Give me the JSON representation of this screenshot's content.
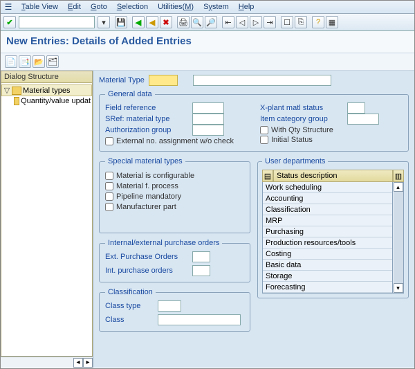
{
  "menu": {
    "control_icon": "window-menu-icon",
    "items": [
      "Table View",
      "Edit",
      "Goto",
      "Selection",
      "Utilities(M)",
      "System",
      "Help"
    ]
  },
  "toolbar": {
    "ok_btn": "✔",
    "dropdown_icon": "▾"
  },
  "page_title": "New Entries: Details of Added Entries",
  "sidebar": {
    "header": "Dialog Structure",
    "items": [
      {
        "label": "Material types",
        "selected": true,
        "expanded": true
      },
      {
        "label": "Quantity/value updat",
        "selected": false,
        "expanded": false
      }
    ]
  },
  "material_type_label": "Material Type",
  "groups": {
    "general": {
      "legend": "General data",
      "field_reference": "Field reference",
      "sref_material_type": "SRef: material type",
      "authorization_group": "Authorization group",
      "external_no": "External no. assignment w/o check",
      "xplant": "X-plant matl status",
      "item_cat": "Item category group",
      "with_qty": "With Qty Structure",
      "initial_status": "Initial Status"
    },
    "special": {
      "legend": "Special material types",
      "items": [
        "Material is configurable",
        "Material f. process",
        "Pipeline mandatory",
        "Manufacturer part"
      ]
    },
    "user_dep": {
      "legend": "User departments",
      "header": "Status description",
      "rows": [
        "Work scheduling",
        "Accounting",
        "Classification",
        "MRP",
        "Purchasing",
        "Production resources/tools",
        "Costing",
        "Basic data",
        "Storage",
        "Forecasting"
      ]
    },
    "iepo": {
      "legend": "Internal/external purchase orders",
      "ext": "Ext. Purchase Orders",
      "int": "Int. purchase orders"
    },
    "classification": {
      "legend": "Classification",
      "class_type": "Class type",
      "class": "Class"
    }
  }
}
